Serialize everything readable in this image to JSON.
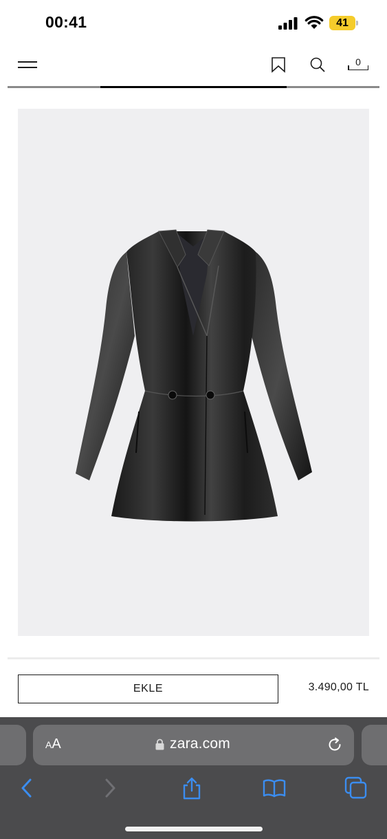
{
  "status_bar": {
    "time": "00:41",
    "battery_level": "41",
    "battery_color": "#f5cc2b"
  },
  "header": {
    "menu_icon": "hamburger-menu-icon",
    "bookmark_icon": "bookmark-icon",
    "search_icon": "search-icon",
    "cart_icon": "shopping-bag-icon",
    "cart_count": "0"
  },
  "gallery": {
    "progress_fraction": 0.5,
    "image_alt_icon": "black-leather-jacket-image",
    "background_color": "#efeff1"
  },
  "product": {
    "add_button_label": "EKLE",
    "price": "3.490,00 TL"
  },
  "browser": {
    "text_size_small": "A",
    "text_size_large": "A",
    "url": "zara.com",
    "lock_icon": "lock-icon",
    "reload_icon": "reload-icon",
    "toolbar": {
      "back_icon": "chevron-left-icon",
      "forward_icon": "chevron-right-icon",
      "share_icon": "share-icon",
      "bookmarks_icon": "open-book-icon",
      "tabs_icon": "tabs-icon"
    },
    "accent_color": "#3b8df0"
  }
}
